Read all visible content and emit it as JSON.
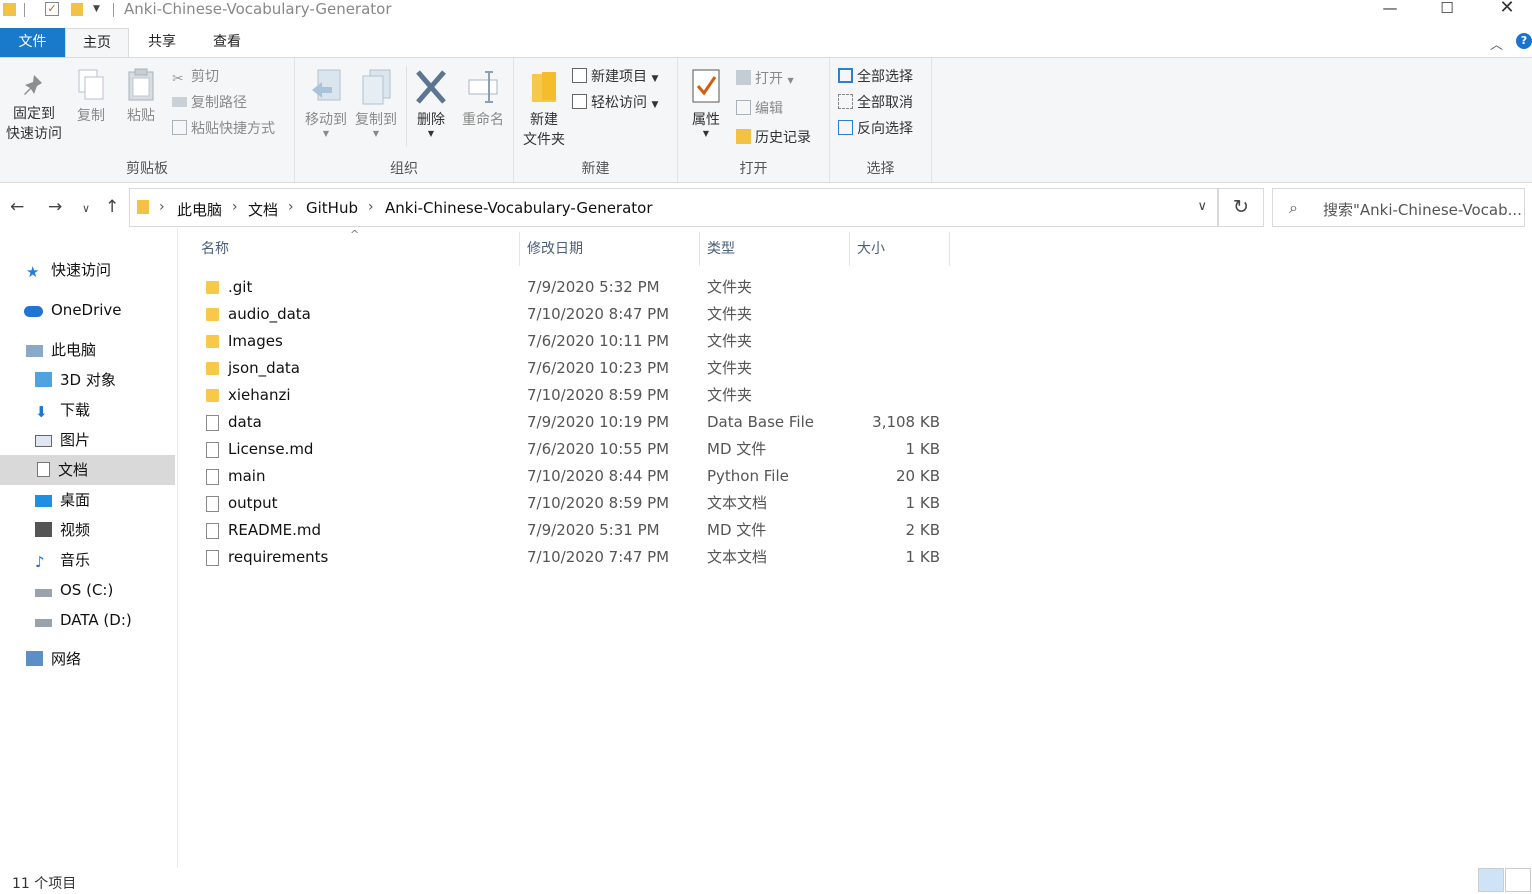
{
  "window": {
    "title": "Anki-Chinese-Vocabulary-Generator",
    "min_icon": "—",
    "max_icon": "☐",
    "close_icon": "✕"
  },
  "tabs": {
    "file": "文件",
    "home": "主页",
    "share": "共享",
    "view": "查看"
  },
  "ribbon": {
    "clipboard": {
      "label": "剪贴板",
      "pin": "固定到\n快速访问",
      "pin_line1": "固定到",
      "pin_line2": "快速访问",
      "copy": "复制",
      "paste": "粘贴",
      "cut": "剪切",
      "copy_path": "复制路径",
      "paste_shortcut": "粘贴快捷方式"
    },
    "organize": {
      "label": "组织",
      "move_to": "移动到",
      "copy_to": "复制到",
      "delete": "删除",
      "rename": "重命名"
    },
    "new": {
      "label": "新建",
      "new_folder_line1": "新建",
      "new_folder_line2": "文件夹",
      "new_item": "新建项目",
      "easy_access": "轻松访问"
    },
    "open": {
      "label": "打开",
      "properties": "属性",
      "open": "打开",
      "edit": "编辑",
      "history": "历史记录"
    },
    "select": {
      "label": "选择",
      "select_all": "全部选择",
      "select_none": "全部取消",
      "invert": "反向选择"
    }
  },
  "address": {
    "crumbs": [
      "此电脑",
      "文档",
      "GitHub",
      "Anki-Chinese-Vocabulary-Generator"
    ],
    "search_placeholder": "搜索\"Anki-Chinese-Vocab..."
  },
  "nav": {
    "quick_access": "快速访问",
    "onedrive": "OneDrive",
    "this_pc": "此电脑",
    "objects3d": "3D 对象",
    "downloads": "下载",
    "pictures": "图片",
    "documents": "文档",
    "desktop": "桌面",
    "videos": "视频",
    "music": "音乐",
    "os_c": "OS (C:)",
    "data_d": "DATA (D:)",
    "network": "网络"
  },
  "columns": {
    "name": "名称",
    "date": "修改日期",
    "type": "类型",
    "size": "大小"
  },
  "files": [
    {
      "name": ".git",
      "date": "7/9/2020 5:32 PM",
      "type": "文件夹",
      "size": "",
      "kind": "folder"
    },
    {
      "name": "audio_data",
      "date": "7/10/2020 8:47 PM",
      "type": "文件夹",
      "size": "",
      "kind": "folder"
    },
    {
      "name": "Images",
      "date": "7/6/2020 10:11 PM",
      "type": "文件夹",
      "size": "",
      "kind": "folder"
    },
    {
      "name": "json_data",
      "date": "7/6/2020 10:23 PM",
      "type": "文件夹",
      "size": "",
      "kind": "folder"
    },
    {
      "name": "xiehanzi",
      "date": "7/10/2020 8:59 PM",
      "type": "文件夹",
      "size": "",
      "kind": "folder"
    },
    {
      "name": "data",
      "date": "7/9/2020 10:19 PM",
      "type": "Data Base File",
      "size": "3,108 KB",
      "kind": "file"
    },
    {
      "name": "License.md",
      "date": "7/6/2020 10:55 PM",
      "type": "MD 文件",
      "size": "1 KB",
      "kind": "file"
    },
    {
      "name": "main",
      "date": "7/10/2020 8:44 PM",
      "type": "Python File",
      "size": "20 KB",
      "kind": "file"
    },
    {
      "name": "output",
      "date": "7/10/2020 8:59 PM",
      "type": "文本文档",
      "size": "1 KB",
      "kind": "file"
    },
    {
      "name": "README.md",
      "date": "7/9/2020 5:31 PM",
      "type": "MD 文件",
      "size": "2 KB",
      "kind": "file"
    },
    {
      "name": "requirements",
      "date": "7/10/2020 7:47 PM",
      "type": "文本文档",
      "size": "1 KB",
      "kind": "file"
    }
  ],
  "status": {
    "count": "11 个项目"
  },
  "colors": {
    "accent": "#1979ca",
    "folder": "#f6c94b",
    "selected": "#d9d9d9"
  }
}
